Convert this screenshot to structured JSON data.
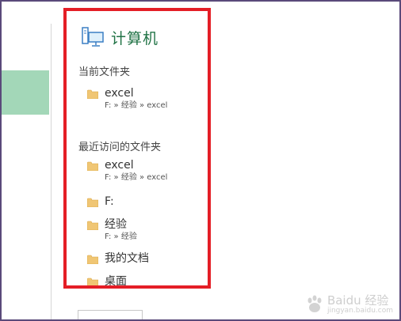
{
  "panel": {
    "title": "计算机",
    "current_label": "当前文件夹",
    "recent_label": "最近访问的文件夹",
    "current_folders": [
      {
        "name": "excel",
        "path": "F: » 经验 » excel"
      }
    ],
    "recent_folders": [
      {
        "name": "excel",
        "path": "F: » 经验 » excel"
      },
      {
        "name": "F:",
        "path": ""
      },
      {
        "name": "经验",
        "path": "F: » 经验"
      },
      {
        "name": "我的文档",
        "path": ""
      },
      {
        "name": "桌面",
        "path": ""
      }
    ]
  },
  "watermark": {
    "text": "Baidu 经验",
    "url": "jingyan.baidu.com"
  },
  "colors": {
    "title_green": "#217346",
    "highlight_red": "#e41e26",
    "accent_green": "#a3d7b8",
    "folder_yellow": "#f0c674"
  },
  "icons": {
    "header": "computer-icon",
    "folder": "folder-icon"
  }
}
